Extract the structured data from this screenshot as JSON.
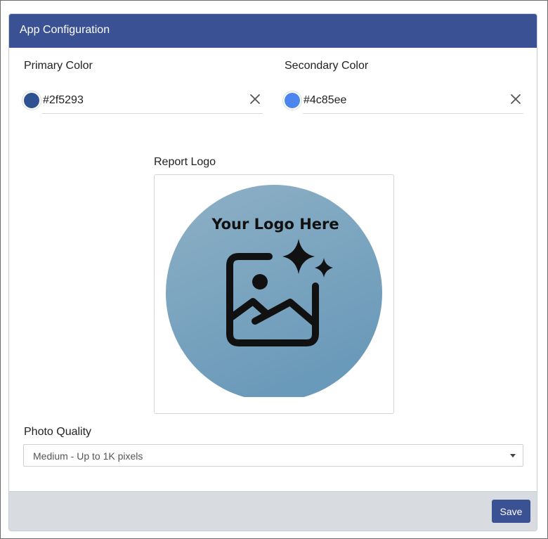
{
  "header": {
    "title": "App Configuration"
  },
  "primary_color": {
    "label": "Primary Color",
    "value": "#2f5293",
    "swatch": "#2f5293"
  },
  "secondary_color": {
    "label": "Secondary Color",
    "value": "#4c85ee",
    "swatch": "#4c85ee"
  },
  "report_logo": {
    "label": "Report Logo",
    "placeholder_text": "Your Logo Here"
  },
  "photo_quality": {
    "label": "Photo Quality",
    "selected": "Medium - Up to 1K pixels"
  },
  "footer": {
    "save_label": "Save"
  },
  "colors": {
    "accent": "#3a5294",
    "footer_bg": "#d8dce1",
    "logo_circle": "#7aa3bf"
  },
  "icons": {
    "clear": "close-icon",
    "logo": "image-sparkle-icon",
    "dropdown": "chevron-down-icon"
  }
}
